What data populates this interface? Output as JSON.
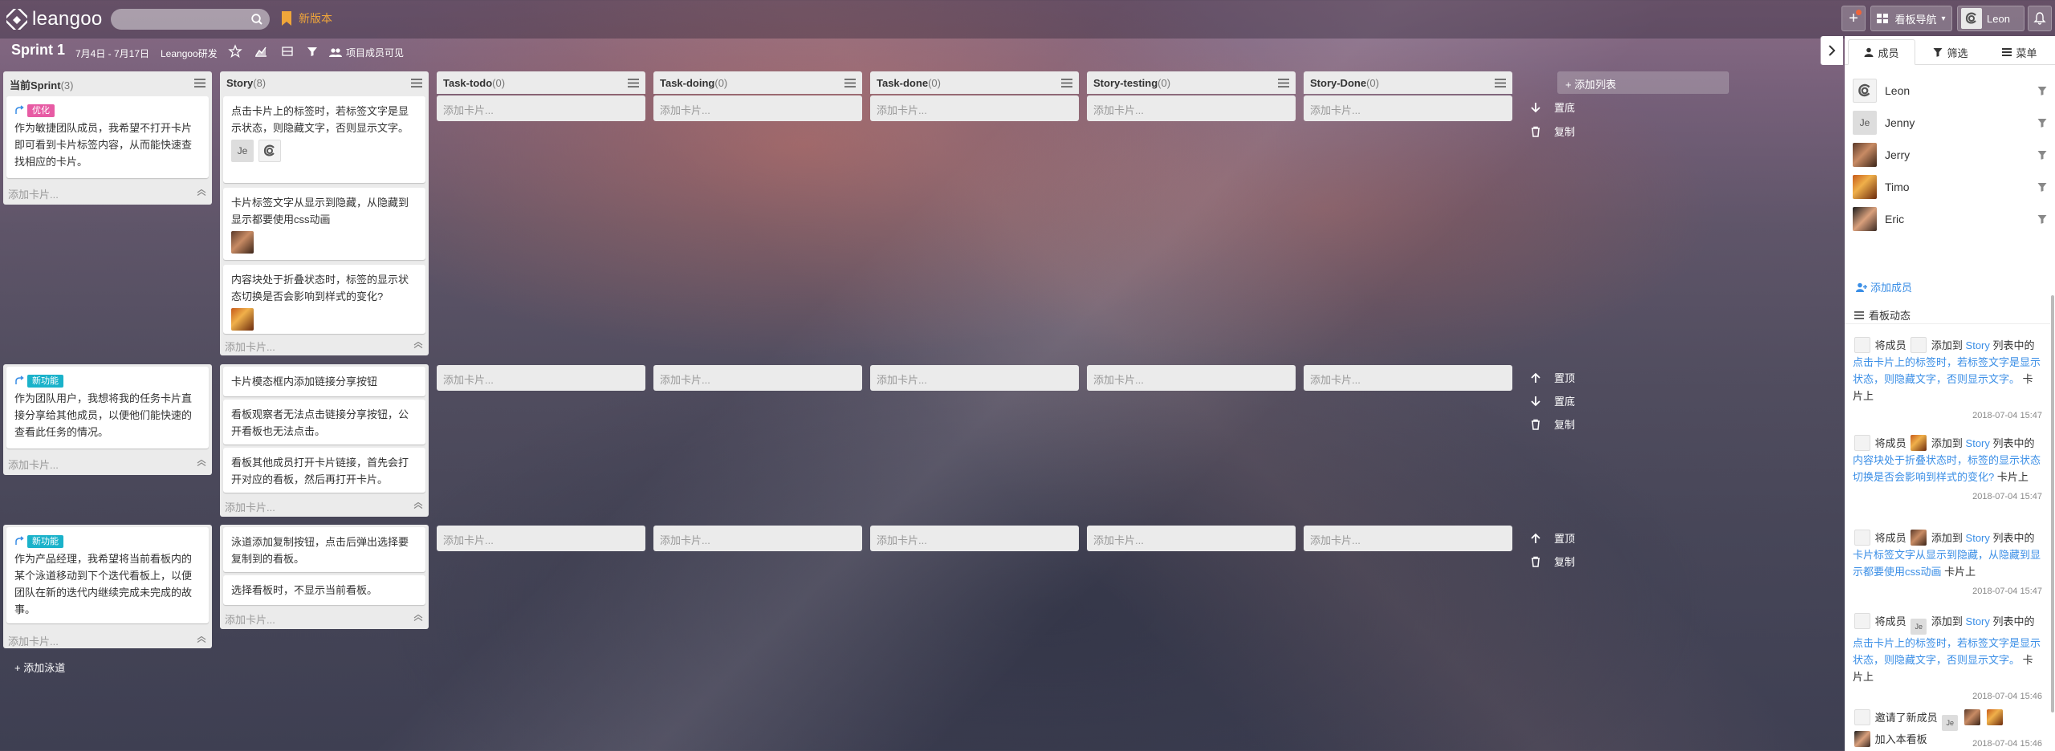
{
  "app": {
    "logo_text": "leangoo",
    "new_version": "新版本"
  },
  "search": {
    "placeholder": ""
  },
  "topbar": {
    "board_nav": "看板导航",
    "user_name": "Leon"
  },
  "sprint": {
    "title": "Sprint 1",
    "dates": "7月4日 - 7月17日",
    "team": "Leangoo研发",
    "visibility": "项目成员可见"
  },
  "columns": [
    {
      "title": "当前Sprint",
      "count": "(3)"
    },
    {
      "title": "Story",
      "count": "(8)"
    },
    {
      "title": "Task-todo",
      "count": "(0)"
    },
    {
      "title": "Task-doing",
      "count": "(0)"
    },
    {
      "title": "Task-done",
      "count": "(0)"
    },
    {
      "title": "Story-testing",
      "count": "(0)"
    },
    {
      "title": "Story-Done",
      "count": "(0)"
    }
  ],
  "lanes": [
    {
      "sprint_card": {
        "tag": "优化",
        "text": "作为敏捷团队成员，我希望不打开卡片即可看到卡片标签内容，从而能快速查找相应的卡片。"
      },
      "story_cards": [
        "点击卡片上的标签时，若标签文字是显示状态，则隐藏文字，否则显示文字。",
        "卡片标签文字从显示到隐藏，从隐藏到显示都要使用css动画",
        "内容块处于折叠状态时，标签的显示状态切换是否会影响到样式的变化?"
      ]
    },
    {
      "sprint_card": {
        "tag": "新功能",
        "text": "作为团队用户，我想将我的任务卡片直接分享给其他成员，以便他们能快速的查看此任务的情况。"
      },
      "story_cards": [
        "卡片模态框内添加链接分享按钮",
        "看板观察者无法点击链接分享按钮，公开看板也无法点击。",
        "看板其他成员打开卡片链接，首先会打开对应的看板，然后再打开卡片。"
      ]
    },
    {
      "sprint_card": {
        "tag": "新功能",
        "text": "作为产品经理，我希望将当前看板内的某个泳道移动到下个迭代看板上，以便团队在新的迭代内继续完成未完成的故事。"
      },
      "story_cards": [
        "泳道添加复制按钮，点击后弹出选择要复制到的看板。",
        "选择看板时，不显示当前看板。"
      ]
    }
  ],
  "add_card": "添加卡片...",
  "add_list": "添加列表",
  "add_lane": "添加泳道",
  "lane_actions": {
    "top": "置顶",
    "bottom": "置底",
    "copy": "复制"
  },
  "panel": {
    "tabs": [
      "成员",
      "筛选",
      "菜单"
    ],
    "members": [
      "Leon",
      "Jenny",
      "Jerry",
      "Timo",
      "Eric"
    ],
    "member_je": "Je",
    "add_member": "添加成员",
    "activity_title": "看板动态",
    "activities": [
      {
        "prefix": "将成员",
        "mid": "添加到",
        "list": "Story",
        "suffix": "列表中的",
        "card": "点击卡片上的标签时，若标签文字是显示状态，则隐藏文字，否则显示文字。",
        "end": "卡片上",
        "time": "2018-07-04 15:47"
      },
      {
        "prefix": "将成员",
        "mid": "添加到",
        "list": "Story",
        "suffix": "列表中的",
        "card": "内容块处于折叠状态时，标签的显示状态切换是否会影响到样式的变化?",
        "end": "卡片上",
        "time": "2018-07-04 15:47"
      },
      {
        "prefix": "将成员",
        "mid": "添加到",
        "list": "Story",
        "suffix": "列表中的",
        "card": "卡片标签文字从显示到隐藏，从隐藏到显示都要使用css动画",
        "end": "卡片上",
        "time": "2018-07-04 15:47"
      },
      {
        "prefix": "将成员",
        "mid": "添加到",
        "list": "Story",
        "suffix": "列表中的",
        "card": "点击卡片上的标签时，若标签文字是显示状态，则隐藏文字，否则显示文字。",
        "end": "卡片上",
        "time": "2018-07-04 15:46"
      },
      {
        "prefix": "邀请了新成员",
        "end": "加入本看板",
        "time": "2018-07-04 15:46"
      }
    ]
  },
  "colors": {
    "accent_blue": "#3a8ee6",
    "tag_optimize": "#e75ba4",
    "tag_new": "#1ab2ca",
    "new_version": "#f0a63a"
  }
}
